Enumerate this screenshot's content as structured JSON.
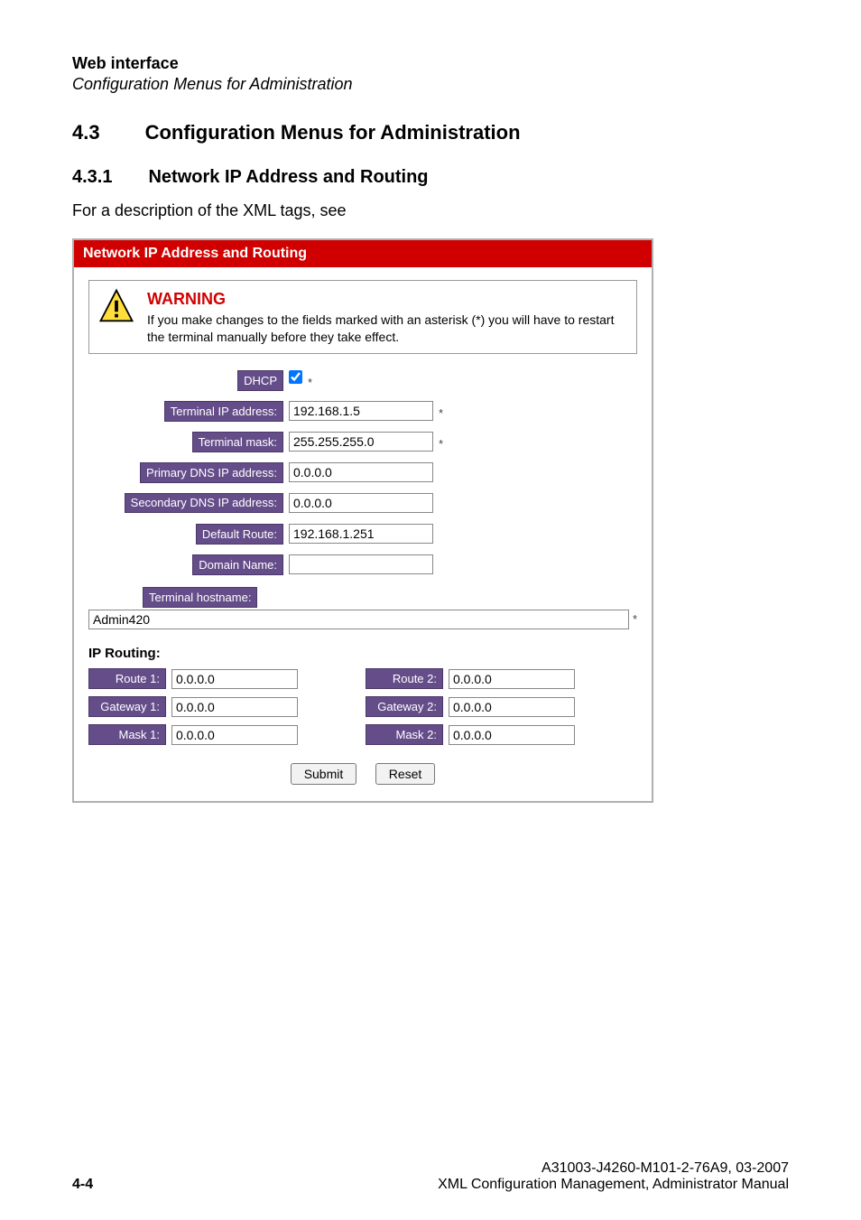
{
  "header": {
    "title_bold": "Web interface",
    "title_italic": "Configuration Menus for Administration"
  },
  "sections": {
    "h2": {
      "num": "4.3",
      "text": "Configuration Menus for Administration"
    },
    "h3": {
      "num": "4.3.1",
      "text": "Network IP Address and Routing"
    },
    "intro": "For a description of the XML tags, see"
  },
  "panel": {
    "title": "Network IP Address and Routing",
    "warning": {
      "heading": "WARNING",
      "body": "If you make changes to the fields marked with an asterisk (*) you will have to restart the terminal manually before they take effect."
    },
    "fields": {
      "dhcp_label": "DHCP",
      "dhcp_checked": true,
      "dhcp_star": "*",
      "terminal_ip_label": "Terminal IP address:",
      "terminal_ip_value": "192.168.1.5",
      "terminal_ip_star": "*",
      "terminal_mask_label": "Terminal mask:",
      "terminal_mask_value": "255.255.255.0",
      "terminal_mask_star": "*",
      "primary_dns_label": "Primary DNS IP address:",
      "primary_dns_value": "0.0.0.0",
      "secondary_dns_label": "Secondary DNS IP address:",
      "secondary_dns_value": "0.0.0.0",
      "default_route_label": "Default Route:",
      "default_route_value": "192.168.1.251",
      "domain_name_label": "Domain Name:",
      "domain_name_value": "",
      "hostname_label": "Terminal hostname:",
      "hostname_value": "Admin420",
      "hostname_star": "*"
    },
    "routing": {
      "heading": "IP Routing:",
      "route1_label": "Route 1:",
      "route1_value": "0.0.0.0",
      "route2_label": "Route 2:",
      "route2_value": "0.0.0.0",
      "gateway1_label": "Gateway 1:",
      "gateway1_value": "0.0.0.0",
      "gateway2_label": "Gateway 2:",
      "gateway2_value": "0.0.0.0",
      "mask1_label": "Mask 1:",
      "mask1_value": "0.0.0.0",
      "mask2_label": "Mask 2:",
      "mask2_value": "0.0.0.0"
    },
    "buttons": {
      "submit": "Submit",
      "reset": "Reset"
    }
  },
  "footer": {
    "page_number": "4-4",
    "doc_id": "A31003-J4260-M101-2-76A9, 03-2007",
    "doc_name": "XML Configuration Management, Administrator Manual"
  }
}
